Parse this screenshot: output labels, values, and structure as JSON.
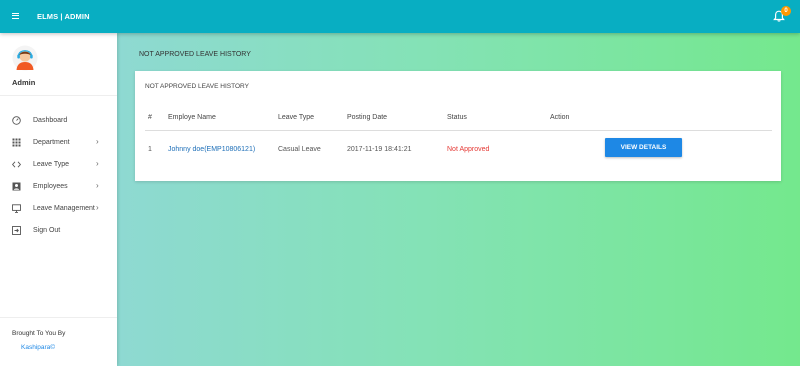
{
  "header": {
    "brand": "ELMS | ADMIN",
    "notification_count": "0"
  },
  "sidebar": {
    "user_name": "Admin",
    "items": [
      {
        "label": "Dashboard",
        "icon": "dashboard-icon",
        "has_submenu": false
      },
      {
        "label": "Department",
        "icon": "grid-icon",
        "has_submenu": true
      },
      {
        "label": "Leave Type",
        "icon": "code-icon",
        "has_submenu": true
      },
      {
        "label": "Employees",
        "icon": "account-box-icon",
        "has_submenu": true
      },
      {
        "label": "Leave Management",
        "icon": "monitor-icon",
        "has_submenu": true
      },
      {
        "label": "Sign Out",
        "icon": "sign-out-icon",
        "has_submenu": false
      }
    ],
    "footer": {
      "label": "Brought To You By",
      "link": "Kashipara©"
    }
  },
  "main": {
    "page_title": "NOT APPROVED LEAVE HISTORY",
    "card": {
      "title": "NOT APPROVED LEAVE HISTORY",
      "columns": [
        "#",
        "Employe Name",
        "Leave Type",
        "Posting Date",
        "Status",
        "Action"
      ],
      "rows": [
        {
          "index": "1",
          "employee": "Johnny doe(EMP10806121)",
          "leave_type": "Casual Leave",
          "posting_date": "2017-11-19 18:41:21",
          "status": "Not Approved",
          "action": "VIEW DETAILS"
        }
      ]
    }
  },
  "colors": {
    "topbar": "#08aec2",
    "primary_button": "#1e88e5",
    "status_not_approved": "#e53935",
    "badge": "#ff9800",
    "link": "#1e6fb8"
  }
}
